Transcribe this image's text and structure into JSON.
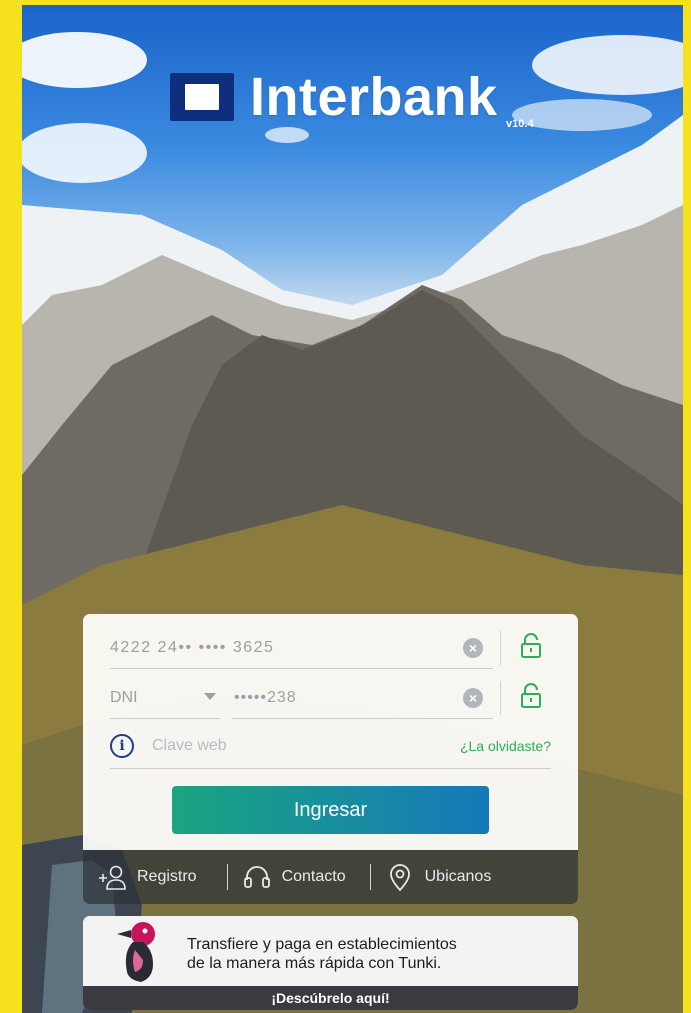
{
  "brand": {
    "name": "Interbank",
    "version": "v10.4"
  },
  "login": {
    "card_number": "4222 24•• •••• 3625",
    "document_type": "DNI",
    "document_number": "•••••238",
    "password_placeholder": "Clave web",
    "forgot_link": "¿La olvidaste?",
    "submit_label": "Ingresar"
  },
  "footer": {
    "items": [
      {
        "label": "Registro",
        "icon": "add-user-icon"
      },
      {
        "label": "Contacto",
        "icon": "headset-icon"
      },
      {
        "label": "Ubicanos",
        "icon": "location-pin-icon"
      }
    ]
  },
  "promo": {
    "line1": "Transfiere y paga en establecimientos",
    "line2": "de la manera más rápida con Tunki.",
    "cta": "¡Descúbrelo aquí!"
  },
  "colors": {
    "accent_green": "#2fae59",
    "brand_navy": "#0f2e7d",
    "button_gradient_start": "#1aa57f",
    "button_gradient_end": "#1579b9",
    "frame_yellow": "#f6e21c"
  }
}
